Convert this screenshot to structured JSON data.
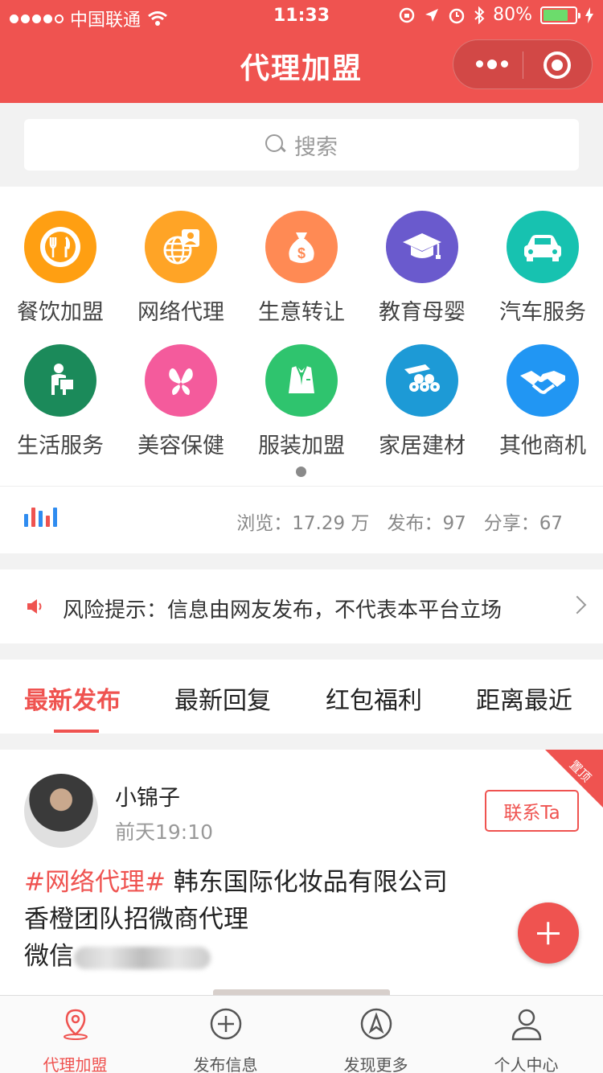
{
  "status_bar": {
    "carrier": "中国联通",
    "time": "11:33",
    "battery": "80%",
    "battery_level": 0.8
  },
  "nav": {
    "title": "代理加盟"
  },
  "search": {
    "placeholder": "搜索"
  },
  "categories": [
    {
      "label": "餐饮加盟",
      "icon": "utensils-icon",
      "color": "#ff9f12"
    },
    {
      "label": "网络代理",
      "icon": "globe-id-icon",
      "color": "#ffa426"
    },
    {
      "label": "生意转让",
      "icon": "money-bag-icon",
      "color": "#ff8a54"
    },
    {
      "label": "教育母婴",
      "icon": "graduation-cap-icon",
      "color": "#6a5acd"
    },
    {
      "label": "汽车服务",
      "icon": "car-icon",
      "color": "#17c2b0"
    },
    {
      "label": "生活服务",
      "icon": "delivery-person-icon",
      "color": "#1b8a5a"
    },
    {
      "label": "美容保健",
      "icon": "butterfly-icon",
      "color": "#f45b9c"
    },
    {
      "label": "服装加盟",
      "icon": "suit-icon",
      "color": "#2fc46e"
    },
    {
      "label": "家居建材",
      "icon": "timber-icon",
      "color": "#1d9ad6"
    },
    {
      "label": "其他商机",
      "icon": "handshake-icon",
      "color": "#2196f3"
    }
  ],
  "stats": {
    "views": "浏览：17.29 万",
    "posts": "发布：97",
    "shares": "分享：67"
  },
  "notice": {
    "text": "风险提示：信息由网友发布，不代表本平台立场"
  },
  "tabs": [
    "最新发布",
    "最新回复",
    "红包福利",
    "距离最近"
  ],
  "post": {
    "username": "小锦子",
    "time": "前天19:10",
    "contact_label": "联系Ta",
    "pinned_label": "置顶",
    "tag": "#网络代理#",
    "line1": " 韩东国际化妆品有限公司",
    "line2": "香橙团队招微商代理",
    "wechat_prefix": "微信"
  },
  "tabbar": [
    {
      "label": "代理加盟",
      "icon": "location-pin-icon",
      "active": true
    },
    {
      "label": "发布信息",
      "icon": "plus-circle-icon",
      "active": false
    },
    {
      "label": "发现更多",
      "icon": "compass-icon",
      "active": false
    },
    {
      "label": "个人中心",
      "icon": "user-icon",
      "active": false
    }
  ],
  "colors": {
    "brand": "#ef5350"
  }
}
